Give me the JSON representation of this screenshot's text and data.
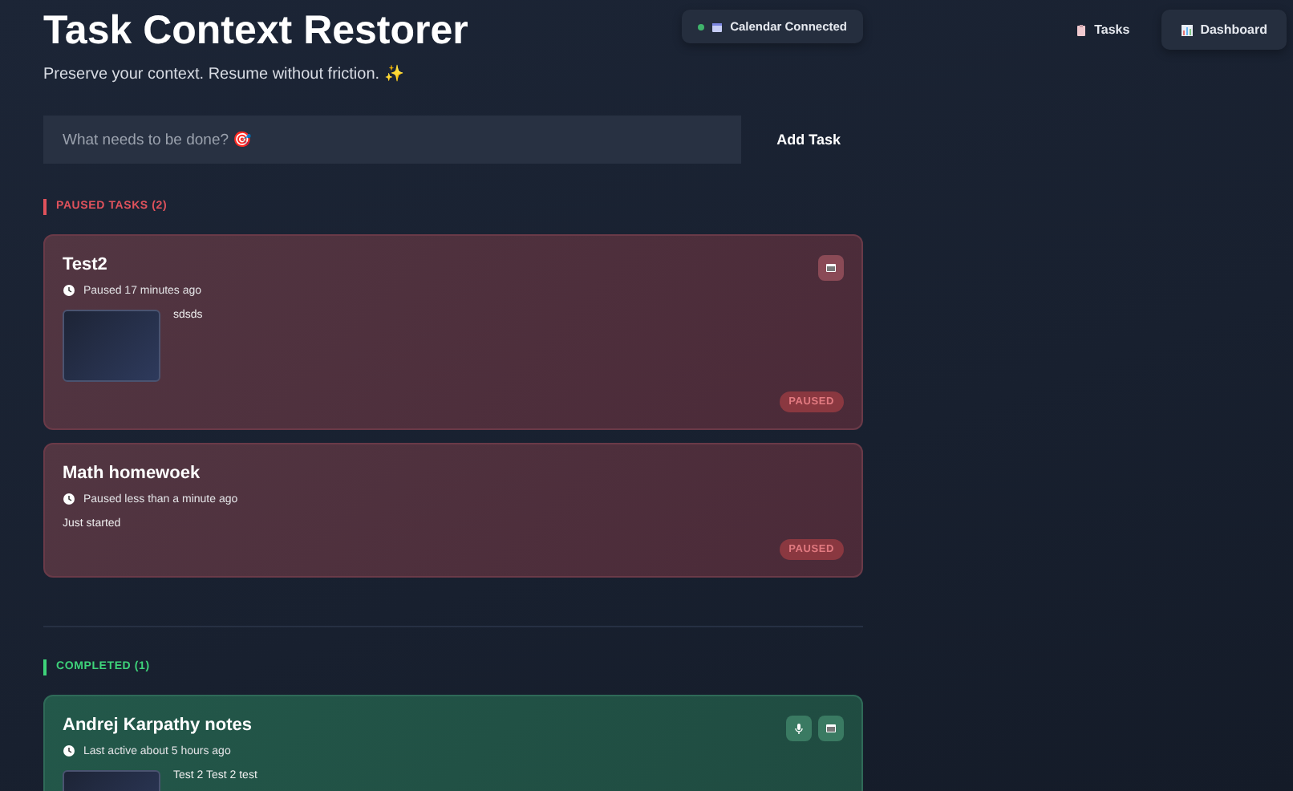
{
  "header": {
    "title": "Task Context Restorer",
    "subtitle": "Preserve your context. Resume without friction. ✨"
  },
  "calendar": {
    "label": "Calendar Connected",
    "connected": true
  },
  "nav": [
    {
      "label": "Tasks",
      "selected": false
    },
    {
      "label": "Dashboard",
      "selected": true
    }
  ],
  "new_task": {
    "placeholder": "What needs to be done? 🎯",
    "button": "Add Task"
  },
  "sections": [
    {
      "kind": "paused",
      "title": "PAUSED TASKS (2)",
      "tasks": [
        {
          "title": "Test2",
          "meta": "Paused 17 minutes ago",
          "has_screenshot": true,
          "note": "sdsds",
          "badge": "PAUSED",
          "actions": [
            {
              "kind": "screen"
            }
          ]
        },
        {
          "title": "Math homewoek",
          "meta": "Paused less than a minute ago",
          "has_screenshot": false,
          "note": "Just started",
          "badge": "PAUSED"
        }
      ]
    },
    {
      "kind": "completed",
      "title": "COMPLETED (1)",
      "tasks": [
        {
          "title": "Andrej Karpathy notes",
          "meta": "Last active about 5 hours ago",
          "has_screenshot": true,
          "note": "Test 2 Test 2 test",
          "actions": [
            {
              "kind": "mic"
            },
            {
              "kind": "screen"
            }
          ]
        }
      ]
    }
  ]
}
